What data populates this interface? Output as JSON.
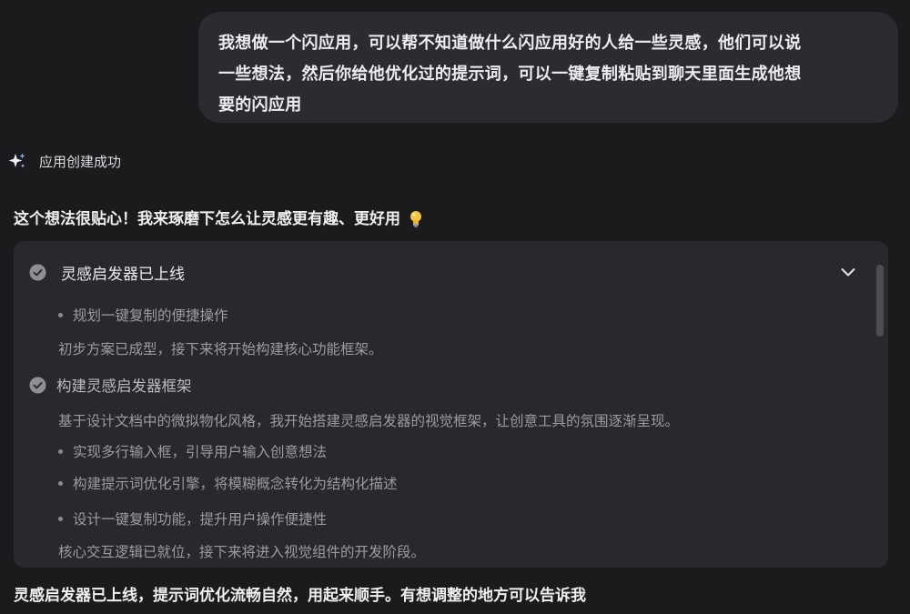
{
  "user_message": {
    "line1": "我想做一个闪应用，可以帮不知道做什么闪应用好的人给一些灵感，他们可以说",
    "line2": "一些想法，然后你给他优化过的提示词，可以一键复制粘贴到聊天里面生成他想",
    "line3": "要的闪应用"
  },
  "app_created": {
    "icon": "sparkle-icon",
    "label": "应用创建成功"
  },
  "reply_intro": {
    "text": "这个想法很贴心！我来琢磨下怎么让灵感更有趣、更好用",
    "icon": "lightbulb-emoji"
  },
  "progress_panel": {
    "title": "灵感启发器已上线",
    "collapse_icon": "chevron-down-icon",
    "items": [
      {
        "type": "bullet",
        "text": "规划一键复制的便捷操作"
      },
      {
        "type": "note",
        "text": "初步方案已成型，接下来将开始构建核心功能框架。"
      },
      {
        "type": "step",
        "text": "构建灵感启发器框架"
      },
      {
        "type": "note",
        "text": "基于设计文档中的微拟物化风格，我开始搭建灵感启发器的视觉框架，让创意工具的氛围逐渐呈现。"
      },
      {
        "type": "bullet",
        "text": "实现多行输入框，引导用户输入创意想法"
      },
      {
        "type": "bullet",
        "text": "构建提示词优化引擎，将模糊概念转化为结构化描述"
      },
      {
        "type": "bullet",
        "text": "设计一键复制功能，提升用户操作便捷性"
      },
      {
        "type": "note",
        "text": "核心交互逻辑已就位，接下来将进入视觉组件的开发阶段。"
      }
    ]
  },
  "final_message": "灵感启发器已上线，提示词优化流畅自然，用起来顺手。有想调整的地方可以告诉我",
  "colors": {
    "background": "#1b1b1d",
    "user_bubble": "#2b2c30",
    "panel": "#28292d",
    "muted_text": "#9b9ca2"
  }
}
